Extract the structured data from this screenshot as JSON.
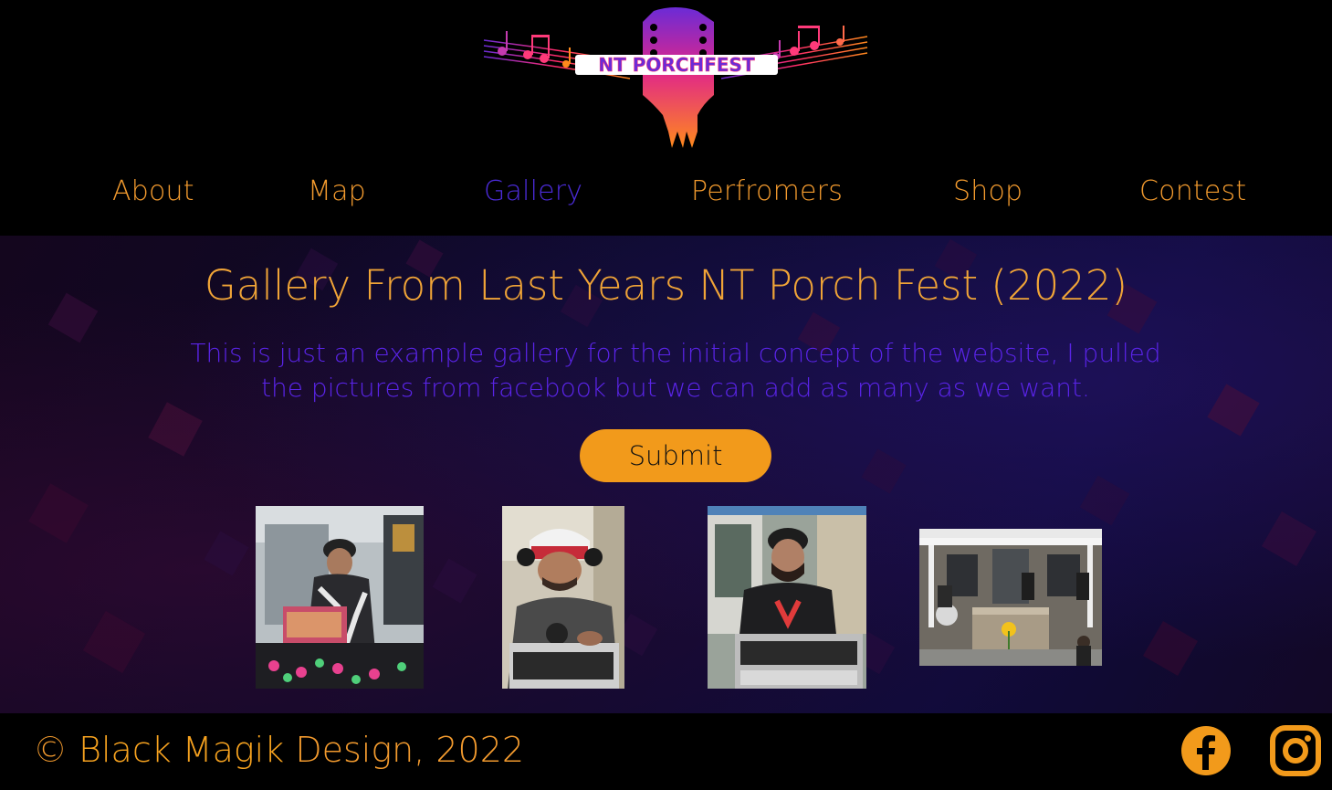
{
  "logo": {
    "text": "NT PORCHFEST",
    "icon": "guitar-headstock-logo"
  },
  "nav": {
    "items": [
      {
        "label": "About",
        "active": false
      },
      {
        "label": "Map",
        "active": false
      },
      {
        "label": "Gallery",
        "active": true
      },
      {
        "label": "Perfromers",
        "active": false
      },
      {
        "label": "Shop",
        "active": false
      },
      {
        "label": "Contest",
        "active": false
      }
    ]
  },
  "main": {
    "title": "Gallery From Last Years NT Porch Fest (2022)",
    "description": "This is just an example gallery for the initial concept of the website, I pulled the pictures from facebook but we can add as many as we want.",
    "submit_label": "Submit",
    "photos": [
      {
        "subject": "dj-mixing-outdoors-photo"
      },
      {
        "subject": "dj-red-cap-headphones-photo"
      },
      {
        "subject": "dj-under-tent-photo"
      },
      {
        "subject": "band-on-porch-photo"
      }
    ]
  },
  "footer": {
    "copyright_symbol": "©",
    "brand": "Black Magik",
    "rest": "Design, 2022",
    "social": [
      "facebook-icon",
      "instagram-icon"
    ]
  },
  "colors": {
    "accent_orange": "#f29a2e",
    "active_purple": "#4b2bd8",
    "button_orange": "#f29a1b",
    "background": "#000000"
  }
}
